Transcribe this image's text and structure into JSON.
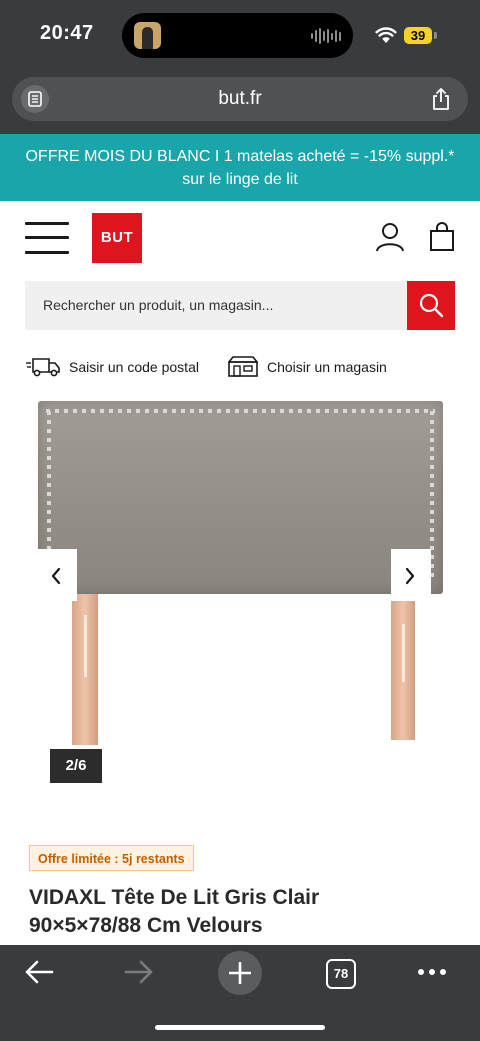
{
  "status_bar": {
    "time": "20:47",
    "battery": "39",
    "wifi_icon": "wifi-icon"
  },
  "browser": {
    "url": "but.fr",
    "open_tabs": "78"
  },
  "promo_banner": {
    "line1": "OFFRE MOIS DU BLANC I 1 matelas acheté = -15% suppl.*",
    "line2": "sur le linge de lit",
    "color": "#1aa5ab"
  },
  "header": {
    "logo": "BUT",
    "brand_color": "#e0141c"
  },
  "search": {
    "placeholder": "Rechercher un produit, un magasin..."
  },
  "delivery": {
    "postal_label": "Saisir un code postal",
    "store_label": "Choisir un magasin"
  },
  "gallery": {
    "counter": "2/6",
    "current_index": 2,
    "total": 6
  },
  "product": {
    "offer_badge": "Offre limitée : 5j restants",
    "title_line1": "VIDAXL Tête De Lit Gris Clair",
    "title_line2": "90×5×78/88 Cm Velours"
  }
}
